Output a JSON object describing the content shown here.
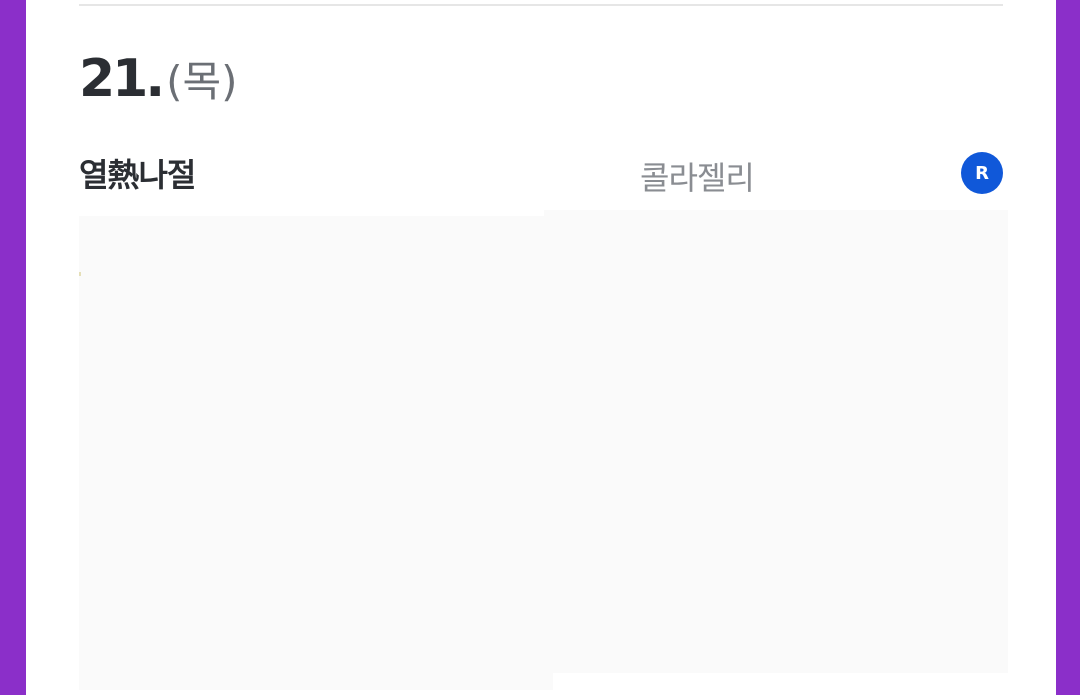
{
  "entry": {
    "date_day": "21.",
    "date_weekday": "(목)",
    "author": "열熱나절",
    "partner": "콜라젤리",
    "badge_letter": "R"
  },
  "colors": {
    "background": "#8b2fc9",
    "badge": "#1058d9",
    "text_primary": "#2b2e33",
    "text_secondary": "#8a8d92"
  }
}
